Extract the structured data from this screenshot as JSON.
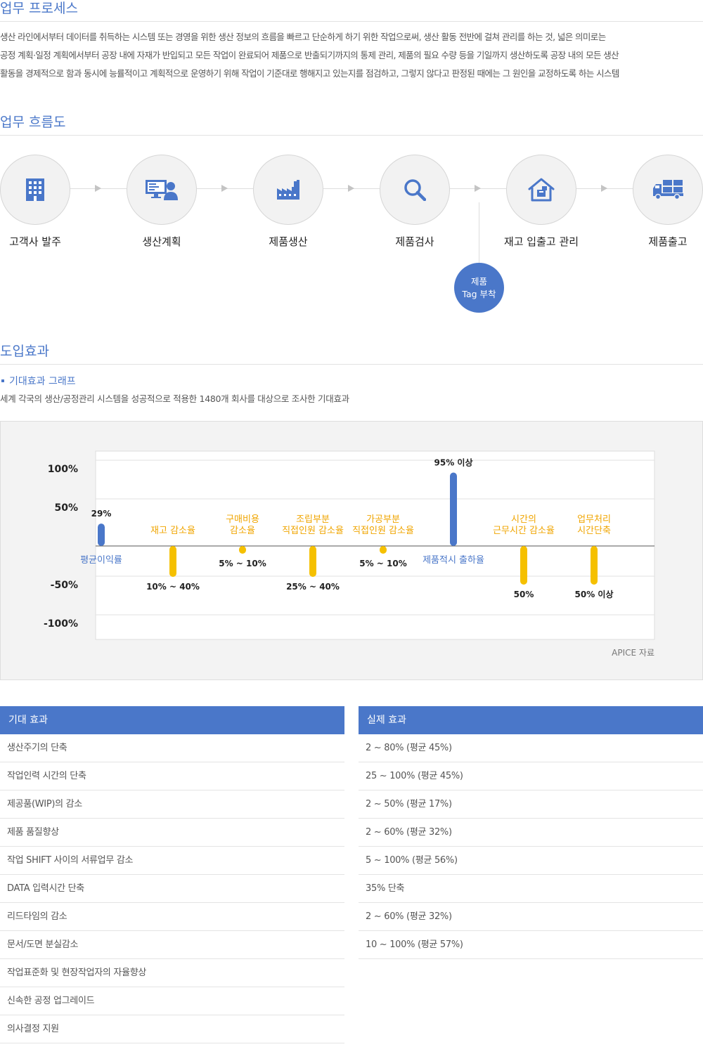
{
  "process": {
    "title": "업무 프로세스",
    "lines": [
      "생산 라인에서부터 데이터를 취득하는 시스템 또는 경영을 위한 생산 정보의 흐름을 빠르고 단순하게 하기 위한 작업으로써, 생산 활동 전반에 걸쳐 관리를 하는 것, 넓은 의미로는",
      "공정 계획·일정 계획에서부터 공장 내에 자재가 반입되고 모든 작업이 완료되어 제품으로 반출되기까지의 통제 관리, 제품의 필요 수량 등을 기일까지 생산하도록 공장 내의 모든 생산",
      "활동을 경제적으로 함과 동시에 능률적이고 계획적으로 운영하기 위해 작업이 기준대로 행해지고 있는지를 점검하고, 그렇지 않다고 판정된 때에는 그 원인을 교정하도록 하는 시스템"
    ]
  },
  "flow": {
    "title": "업무 흐름도",
    "steps": [
      {
        "label": "고객사 발주",
        "icon": "building-icon"
      },
      {
        "label": "생산계획",
        "icon": "planning-icon"
      },
      {
        "label": "제품생산",
        "icon": "factory-icon"
      },
      {
        "label": "제품검사",
        "icon": "magnifier-icon"
      },
      {
        "label": "재고 입출고 관리",
        "icon": "warehouse-icon"
      },
      {
        "label": "제품출고",
        "icon": "truck-icon"
      }
    ],
    "tag_line1": "제품",
    "tag_line2": "Tag 부착"
  },
  "effects": {
    "title": "도입효과",
    "graph_title": "기대효과 그래프",
    "graph_desc": "세계 각국의 생산/공정관리 시스템을 성공적으로 적용한 1480개 회사를 대상으로 조사한 기대효과",
    "source": "APICE 자료"
  },
  "chart_data": {
    "type": "bar",
    "y_ticks": [
      "100%",
      "50%",
      "-50%",
      "-100%"
    ],
    "ylim": [
      -100,
      100
    ],
    "colors": {
      "positive": "#4a77c9",
      "negative": "#f5c000",
      "negative_label": "#f0a500"
    },
    "bars": [
      {
        "category": "평균이익률",
        "value": 29,
        "value_label": "29%"
      },
      {
        "category": "재고 감소율",
        "value": -40,
        "value_label": "10% ~ 40%"
      },
      {
        "category": "구매비용\n감소율",
        "value": -10,
        "value_label": "5% ~ 10%"
      },
      {
        "category": "조립부분\n직접인원 감소율",
        "value": -40,
        "value_label": "25% ~ 40%"
      },
      {
        "category": "가공부분\n직접인원 감소율",
        "value": -10,
        "value_label": "5% ~ 10%"
      },
      {
        "category": "제품적시 출하율",
        "value": 95,
        "value_label": "95% 이상"
      },
      {
        "category": "시간의\n근무시간 감소율",
        "value": -50,
        "value_label": "50%"
      },
      {
        "category": "업무처리\n시간단축",
        "value": -50,
        "value_label": "50% 이상"
      }
    ]
  },
  "table": {
    "expected_header": "기대 효과",
    "actual_header": "실제 효과",
    "expected": [
      "생산주기의 단축",
      "작업인력 시간의 단축",
      "제공품(WIP)의 감소",
      "제품 품질향상",
      "작업 SHIFT 사이의 서류업무 감소",
      "DATA 입력시간 단축",
      "리드타임의 감소",
      "문서/도면 분실감소",
      "작업표준화 및 현장작업자의 자율향상",
      "신속한 공정 업그레이드",
      "의사결정 지원"
    ],
    "actual": [
      "2 ~ 80% (평균 45%)",
      "25 ~ 100% (평균 45%)",
      "2 ~ 50% (평균 17%)",
      "2 ~ 60% (평균 32%)",
      "5 ~ 100% (평균 56%)",
      "35% 단축",
      "2 ~ 60% (평균 32%)",
      "10 ~ 100% (평균 57%)"
    ]
  }
}
